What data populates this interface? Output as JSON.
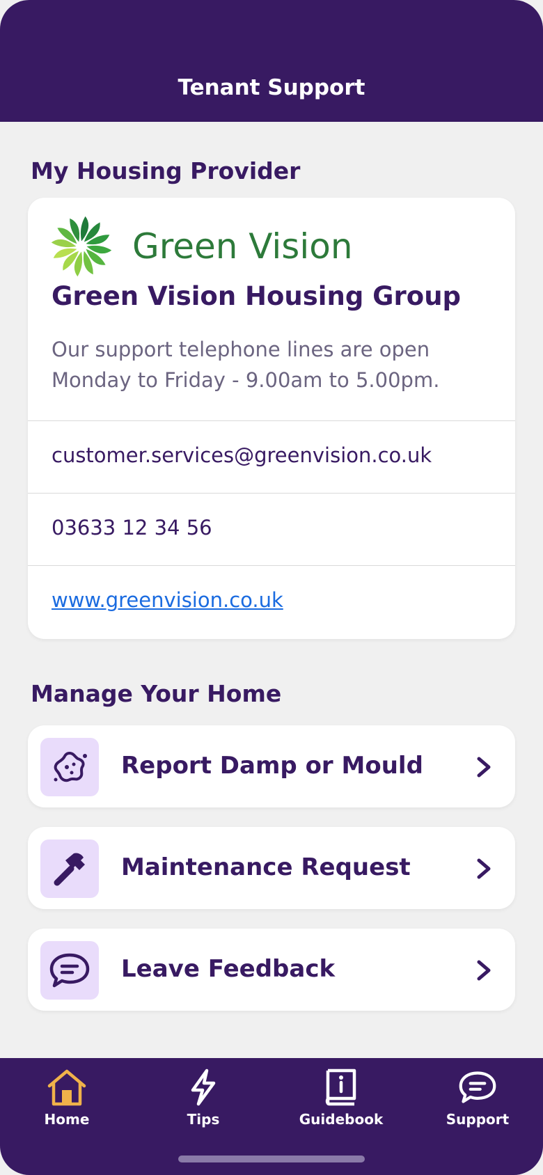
{
  "header": {
    "title": "Tenant Support"
  },
  "provider_section": {
    "title": "My Housing Provider",
    "logo_text": "Green Vision",
    "org_name": "Green Vision Housing Group",
    "hours_line1": "Our support telephone lines are open",
    "hours_line2": "Monday to Friday - 9.00am to 5.00pm.",
    "email": "customer.services@greenvision.co.uk",
    "phone": "03633 12 34 56",
    "website": "www.greenvision.co.uk"
  },
  "manage_section": {
    "title": "Manage Your Home",
    "actions": [
      {
        "label": "Report Damp or Mould",
        "icon": "mould-icon"
      },
      {
        "label": "Maintenance Request",
        "icon": "hammer-icon"
      },
      {
        "label": "Leave Feedback",
        "icon": "chat-bubble-icon"
      }
    ]
  },
  "tabbar": {
    "tabs": [
      {
        "label": "Home",
        "icon": "home-icon",
        "active": true
      },
      {
        "label": "Tips",
        "icon": "lightning-icon",
        "active": false
      },
      {
        "label": "Guidebook",
        "icon": "book-icon",
        "active": false
      },
      {
        "label": "Support",
        "icon": "chat-bubble-icon",
        "active": false
      }
    ]
  },
  "colors": {
    "brand_purple": "#381a62",
    "icon_bg": "#e9dcfb",
    "active_tab": "#f0b24a",
    "link": "#1a6be0",
    "logo_green": "#2d7a3a"
  }
}
